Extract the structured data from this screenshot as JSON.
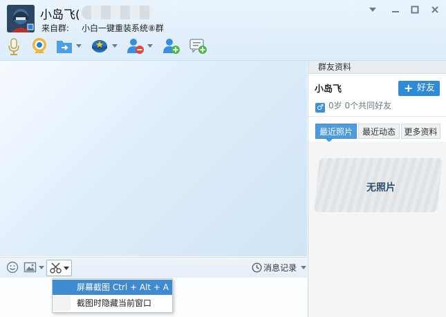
{
  "header": {
    "contact_name": "小岛飞(",
    "from_label": "来自群:",
    "group_name": "小白一键重装系统⑧群"
  },
  "window_controls": [
    "chevron-down-icon",
    "minimize-icon",
    "maximize-icon",
    "close-icon"
  ],
  "toolbar": {
    "icons": [
      "microphone-icon",
      "webcam-icon",
      "send-file-icon",
      "remote-assist-icon",
      "remove-friend-icon",
      "add-friend-icon",
      "new-message-icon"
    ]
  },
  "input_bar": {
    "history_label": "消息记录"
  },
  "screenshot_menu": {
    "items": [
      {
        "label": "屏幕截图 Ctrl + Alt + A",
        "selected": true
      },
      {
        "label": "截图时隐藏当前窗口",
        "selected": false
      }
    ]
  },
  "profile_panel": {
    "title": "群友资料",
    "name": "小岛飞",
    "add_friend_label": "好友",
    "gender_symbol": "♂",
    "info": "0岁 0个共同好友",
    "tabs": [
      "最近照片",
      "最近动态",
      "更多资料"
    ],
    "active_tab": "最近照片",
    "no_photo_label": "无照片"
  },
  "colors": {
    "accent": "#2f8bd8",
    "menu_selected": "#3f8ad1"
  }
}
